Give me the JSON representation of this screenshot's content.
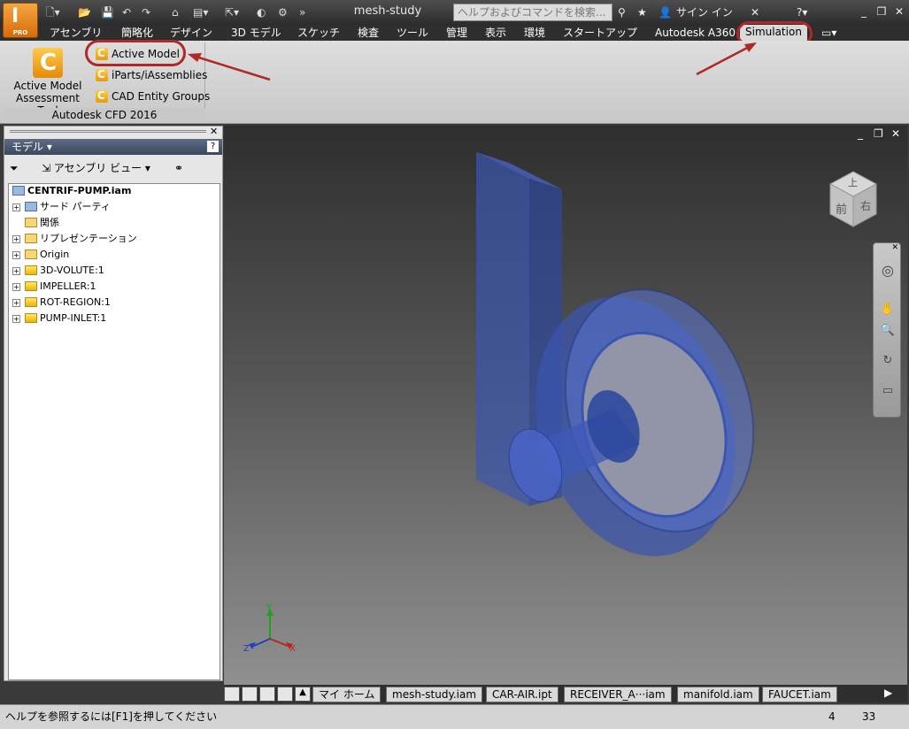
{
  "titlebar": {
    "doc_title": "mesh-study",
    "search_placeholder": "ヘルプおよびコマンドを検索...",
    "sign_in": "サイン イン",
    "app_badge": "PRO",
    "app_letter": "I"
  },
  "tabs": [
    {
      "label": "アセンブリ"
    },
    {
      "label": "簡略化"
    },
    {
      "label": "デザイン"
    },
    {
      "label": "3D モデル"
    },
    {
      "label": "スケッチ"
    },
    {
      "label": "検査"
    },
    {
      "label": "ツール"
    },
    {
      "label": "管理"
    },
    {
      "label": "表示"
    },
    {
      "label": "環境"
    },
    {
      "label": "スタートアップ"
    },
    {
      "label": "Autodesk A360"
    },
    {
      "label": "Simulation"
    }
  ],
  "ribbon": {
    "big_button": {
      "line1": "Active Model",
      "line2": "Assessment Tool"
    },
    "buttons": [
      {
        "label": "Active Model"
      },
      {
        "label": "iParts/iAssemblies"
      },
      {
        "label": "CAD Entity Groups"
      }
    ],
    "panel_label": "Autodesk CFD 2016"
  },
  "browser": {
    "title": "モデル",
    "view": "アセンブリ ビュー",
    "root": "CENTRIF-PUMP.iam",
    "nodes": [
      {
        "label": "サード パーティ"
      },
      {
        "label": "関係"
      },
      {
        "label": "リプレゼンテーション"
      },
      {
        "label": "Origin"
      },
      {
        "label": "3D-VOLUTE:1"
      },
      {
        "label": "IMPELLER:1"
      },
      {
        "label": "ROT-REGION:1"
      },
      {
        "label": "PUMP-INLET:1"
      }
    ]
  },
  "viewcube": {
    "top": "上",
    "front": "前",
    "right": "右"
  },
  "triad": {
    "x": "X",
    "y": "Y",
    "z": "Z"
  },
  "doc_tabs": [
    {
      "label": "マイ ホーム"
    },
    {
      "label": "mesh-study.iam"
    },
    {
      "label": "CAR-AIR.ipt"
    },
    {
      "label": "RECEIVER_A···iam"
    },
    {
      "label": "manifold.iam"
    },
    {
      "label": "FAUCET.iam"
    }
  ],
  "status": {
    "message": "ヘルプを参照するには[F1]を押してください",
    "count1": "4",
    "count2": "33"
  },
  "colors": {
    "accent_red": "#b02828",
    "model_blue": "#3a55b0",
    "icon_orange": "#f2a21a"
  }
}
